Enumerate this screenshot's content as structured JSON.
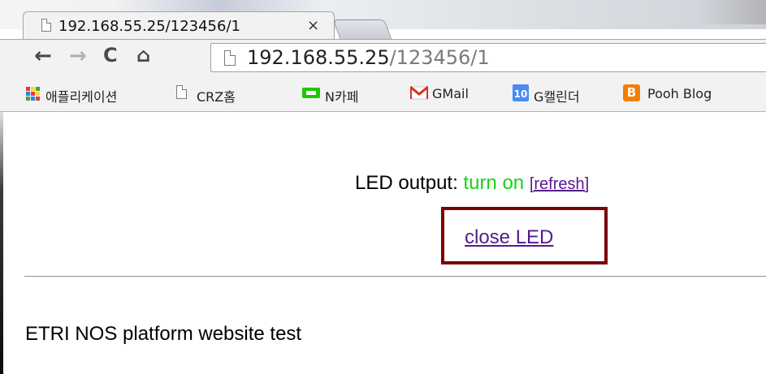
{
  "browser": {
    "tab": {
      "title": "192.168.55.25/123456/1",
      "close_glyph": "×",
      "icon": "document-icon"
    },
    "toolbar": {
      "back_glyph": "←",
      "forward_glyph": "→",
      "reload_glyph": "C",
      "home_glyph": "⌂",
      "url_host": "192.168.55.25",
      "url_path": "/123456/1"
    },
    "bookmarks": [
      {
        "label": "애플리케이션",
        "icon": "apps-grid-icon"
      },
      {
        "label": "CRZ홈",
        "icon": "document-icon"
      },
      {
        "label": "N카페",
        "icon": "naver-cafe-icon"
      },
      {
        "label": "GMail",
        "icon": "gmail-icon"
      },
      {
        "label": "G캘린더",
        "icon": "calendar-icon",
        "icon_text": "10"
      },
      {
        "label": "Pooh Blog",
        "icon": "blogger-icon",
        "icon_text": "B"
      }
    ]
  },
  "page": {
    "led_label": "LED output:",
    "led_state": "turn on",
    "refresh_link": "[refresh]",
    "close_link": "close LED",
    "footer": "ETRI NOS platform website test"
  },
  "colors": {
    "led_state": "#17d117",
    "visited_link": "#551a8b",
    "highlight_box": "#7a0000"
  }
}
